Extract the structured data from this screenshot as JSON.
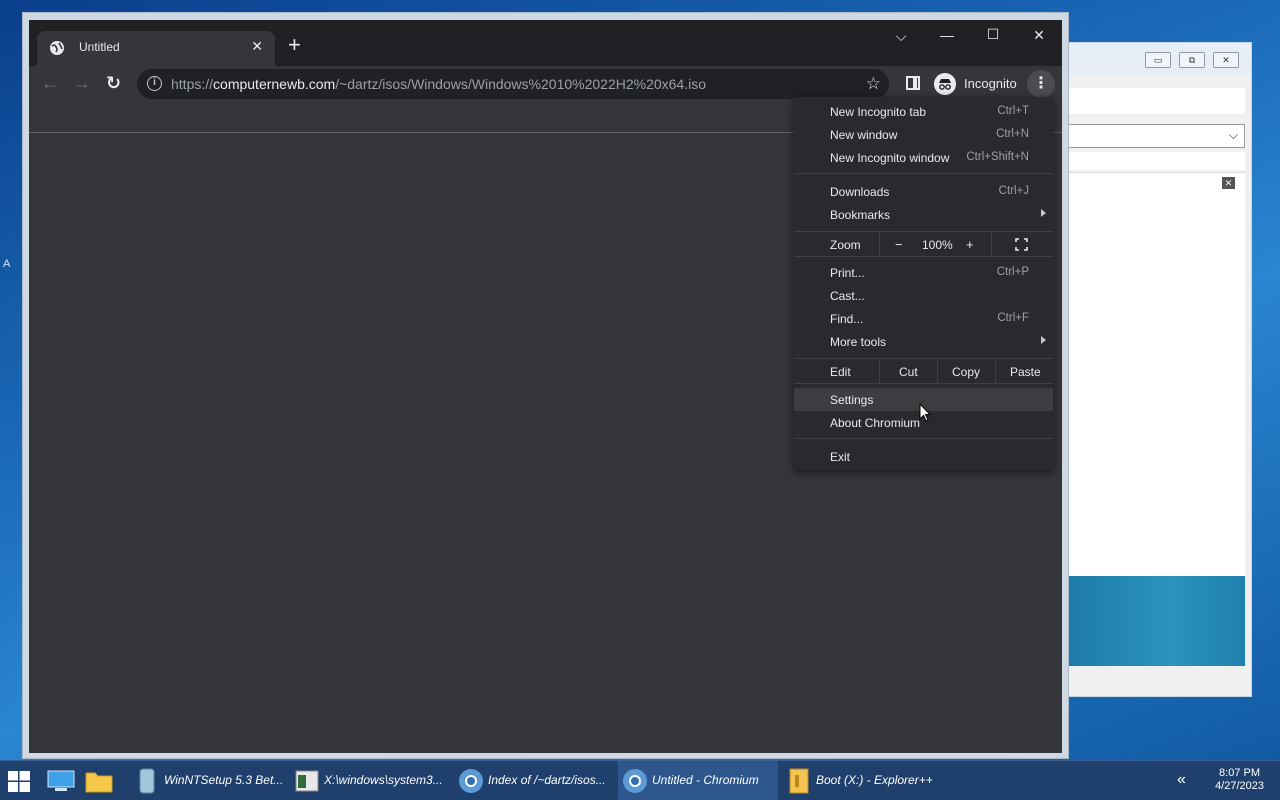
{
  "browser": {
    "tab_title": "Untitled",
    "url_host": "computernewb.com",
    "url_prefix": "https://",
    "url_path": "/~dartz/isos/Windows/Windows%2010%2022H2%20x64.iso",
    "profile_label": "Incognito"
  },
  "menu": {
    "new_incognito_tab": {
      "label": "New Incognito tab",
      "shortcut": "Ctrl+T"
    },
    "new_window": {
      "label": "New window",
      "shortcut": "Ctrl+N"
    },
    "new_incognito_window": {
      "label": "New Incognito window",
      "shortcut": "Ctrl+Shift+N"
    },
    "downloads": {
      "label": "Downloads",
      "shortcut": "Ctrl+J"
    },
    "bookmarks": {
      "label": "Bookmarks"
    },
    "zoom": {
      "label": "Zoom",
      "minus": "−",
      "value": "100%",
      "plus": "+"
    },
    "print": {
      "label": "Print...",
      "shortcut": "Ctrl+P"
    },
    "cast": {
      "label": "Cast..."
    },
    "find": {
      "label": "Find...",
      "shortcut": "Ctrl+F"
    },
    "more_tools": {
      "label": "More tools"
    },
    "edit": {
      "label": "Edit",
      "cut": "Cut",
      "copy": "Copy",
      "paste": "Paste"
    },
    "settings": {
      "label": "Settings"
    },
    "about": {
      "label": "About Chromium"
    },
    "exit": {
      "label": "Exit"
    }
  },
  "taskbar": {
    "items": [
      {
        "label": "WinNTSetup 5.3 Bet..."
      },
      {
        "label": "X:\\windows\\system3..."
      },
      {
        "label": "Index of /~dartz/isos..."
      },
      {
        "label": "Untitled - Chromium"
      },
      {
        "label": "Boot (X:) - Explorer++"
      }
    ],
    "time": "8:07 PM",
    "date": "4/27/2023"
  },
  "colors": {
    "frame": "#202124",
    "toolbar": "#35363a",
    "menu": "#292a2d",
    "taskbar": "#1f3f6d"
  }
}
